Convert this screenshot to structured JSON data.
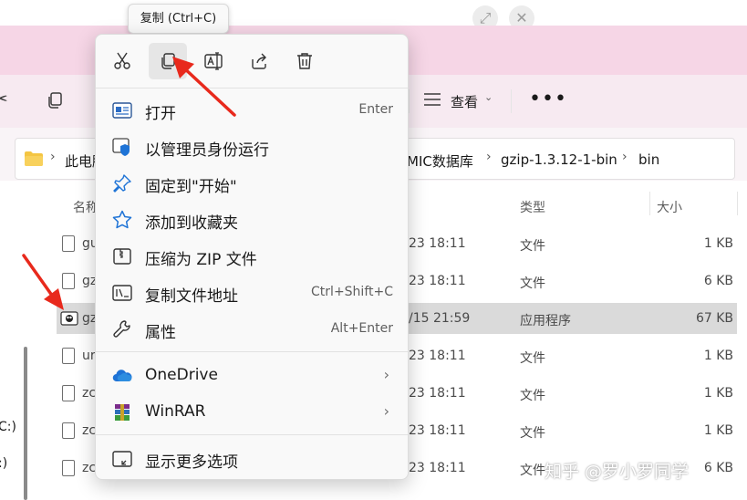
{
  "tooltip": {
    "text": "复制 (Ctrl+C)"
  },
  "explorer": {
    "toolbar": {
      "view_label": "查看"
    },
    "breadcrumb": {
      "root": "此电脑",
      "seg_database": "MIC数据库",
      "seg_folder": "gzip-1.3.12-1-bin",
      "seg_current": "bin"
    },
    "columns": {
      "name": "名称",
      "type": "类型",
      "size": "大小"
    },
    "rows": [
      {
        "name": "gu",
        "date": "23 18:11",
        "type": "文件",
        "size": "1 KB"
      },
      {
        "name": "gz",
        "date": "23 18:11",
        "type": "文件",
        "size": "6 KB"
      },
      {
        "name": "gz",
        "date": "/15 21:59",
        "type": "应用程序",
        "size": "67 KB"
      },
      {
        "name": "ur",
        "date": "23 18:11",
        "type": "文件",
        "size": "1 KB"
      },
      {
        "name": "zc",
        "date": "23 18:11",
        "type": "文件",
        "size": "1 KB"
      },
      {
        "name": "zc",
        "date": "23 18:11",
        "type": "文件",
        "size": "1 KB"
      },
      {
        "name": "zc",
        "date": "23 18:11",
        "type": "文件",
        "size": "6 KB"
      }
    ],
    "nav_drive_1": "C:)",
    "nav_drive_2": ":)"
  },
  "context_menu": {
    "quick_actions": [
      {
        "icon": "scissors-icon",
        "label": "剪切"
      },
      {
        "icon": "copy-icon",
        "label": "复制"
      },
      {
        "icon": "rename-icon",
        "label": "重命名"
      },
      {
        "icon": "share-icon",
        "label": "共享"
      },
      {
        "icon": "trash-icon",
        "label": "删除"
      }
    ],
    "items": [
      {
        "label": "打开",
        "shortcut": "Enter",
        "icon": "open-icon"
      },
      {
        "label": "以管理员身份运行",
        "icon": "shield-icon"
      },
      {
        "label": "固定到\"开始\"",
        "icon": "pin-icon"
      },
      {
        "label": "添加到收藏夹",
        "icon": "star-icon"
      },
      {
        "label": "压缩为 ZIP 文件",
        "icon": "zip-icon"
      },
      {
        "label": "复制文件地址",
        "shortcut": "Ctrl+Shift+C",
        "icon": "path-icon"
      },
      {
        "label": "属性",
        "shortcut": "Alt+Enter",
        "icon": "wrench-icon"
      },
      {
        "label": "OneDrive",
        "icon": "onedrive-icon"
      },
      {
        "label": "WinRAR",
        "icon": "winrar-icon"
      },
      {
        "label": "显示更多选项",
        "icon": "more-options-icon"
      }
    ]
  },
  "watermark": "知乎 @罗小罗同学",
  "colors": {
    "accent": "#0067c0",
    "arrow": "#e8291c",
    "tab_band": "#f6d6e6"
  }
}
